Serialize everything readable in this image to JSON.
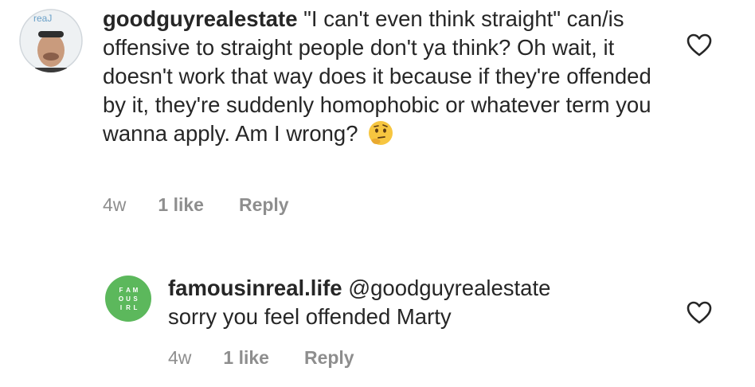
{
  "comments": [
    {
      "username": "goodguyrealestate",
      "text": "\"I can't even think straight\" can/is offensive to straight people don't ya think? Oh wait, it doesn't work that way does it because if they're offended by it, they're suddenly homophobic or whatever term you wanna apply. Am I wrong?",
      "emoji": "thinking-face-icon",
      "age": "4w",
      "likes": "1 like",
      "reply_label": "Reply",
      "avatar_text": "reaJ"
    },
    {
      "username": "famousinreal.life",
      "mention": "@goodguyrealestate",
      "text": "sorry you feel offended Marty",
      "age": "4w",
      "likes": "1 like",
      "reply_label": "Reply",
      "avatar_text": "FAM OUS IRL",
      "avatar_color": "#5cb85c"
    }
  ]
}
